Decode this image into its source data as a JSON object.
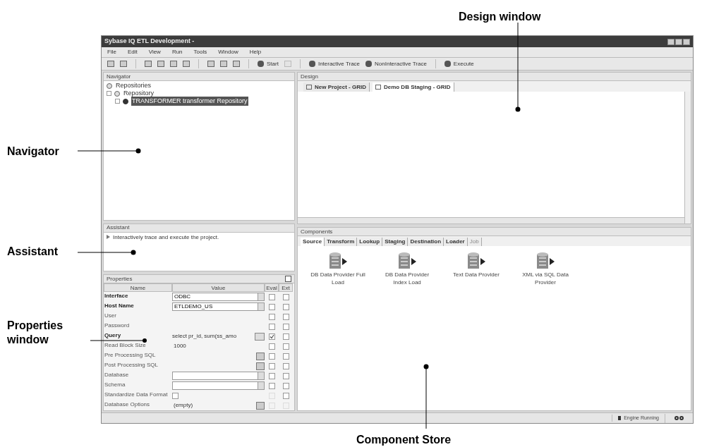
{
  "window": {
    "title": "Sybase IQ ETL Development -"
  },
  "menu": [
    "File",
    "Edit",
    "View",
    "Run",
    "Tools",
    "Window",
    "Help"
  ],
  "toolbar": [
    {
      "kind": "icon",
      "disabled": false
    },
    {
      "kind": "icon",
      "disabled": false
    },
    {
      "kind": "separator"
    },
    {
      "kind": "icon",
      "disabled": false
    },
    {
      "kind": "icon",
      "disabled": false
    },
    {
      "kind": "icon",
      "disabled": false
    },
    {
      "kind": "icon",
      "disabled": false
    },
    {
      "kind": "separator"
    },
    {
      "kind": "icon",
      "disabled": false
    },
    {
      "kind": "icon",
      "disabled": false
    },
    {
      "kind": "icon",
      "disabled": false
    },
    {
      "kind": "separator"
    },
    {
      "kind": "labeled",
      "label": "Start"
    },
    {
      "kind": "icon",
      "disabled": true
    },
    {
      "kind": "separator"
    },
    {
      "kind": "labeled",
      "label": "Interactive Trace"
    },
    {
      "kind": "labeled",
      "label": "NonInteractive Trace"
    },
    {
      "kind": "separator"
    },
    {
      "kind": "labeled",
      "label": "Execute"
    }
  ],
  "navigator": {
    "title": "Navigator",
    "tree": [
      {
        "label": "Repositories",
        "expanded": false,
        "selected": false
      },
      {
        "label": "Repository",
        "expanded": true,
        "selected": false,
        "children": [
          {
            "label": "TRANSFORMER transformer Repository",
            "expanded": false,
            "selected": true
          }
        ]
      }
    ]
  },
  "assistant": {
    "title": "Assistant",
    "text": "Interactively trace and execute the project."
  },
  "properties": {
    "title": "Properties",
    "columns": [
      "Name",
      "Value",
      "Eval",
      "Ext"
    ],
    "rows": [
      {
        "name": "Interface",
        "bold": true,
        "kind": "combo",
        "value": "ODBC",
        "eval": {
          "checked": false,
          "disabled": false
        },
        "ext": {
          "checked": false,
          "disabled": false
        }
      },
      {
        "name": "Host Name",
        "bold": true,
        "kind": "combo",
        "value": "ETLDEMO_US",
        "eval": {
          "checked": false,
          "disabled": false
        },
        "ext": {
          "checked": false,
          "disabled": false
        }
      },
      {
        "name": "User",
        "bold": false,
        "kind": "text",
        "value": "",
        "eval": {
          "checked": false,
          "disabled": false
        },
        "ext": {
          "checked": false,
          "disabled": false
        }
      },
      {
        "name": "Password",
        "bold": false,
        "kind": "text",
        "value": "",
        "eval": {
          "checked": false,
          "disabled": false
        },
        "ext": {
          "checked": false,
          "disabled": false
        }
      },
      {
        "name": "Query",
        "bold": true,
        "kind": "query",
        "value": "select pr_id, sum(ss_amo",
        "eval": {
          "checked": true,
          "disabled": false
        },
        "ext": {
          "checked": false,
          "disabled": false
        }
      },
      {
        "name": "Read Block Size",
        "bold": false,
        "kind": "text",
        "value": "1000",
        "eval": {
          "checked": false,
          "disabled": false
        },
        "ext": {
          "checked": false,
          "disabled": false
        }
      },
      {
        "name": "Pre Processing SQL",
        "bold": false,
        "kind": "editor",
        "value": "",
        "eval": {
          "checked": false,
          "disabled": false
        },
        "ext": {
          "checked": false,
          "disabled": false
        }
      },
      {
        "name": "Post Processing SQL",
        "bold": false,
        "kind": "editor",
        "value": "",
        "eval": {
          "checked": false,
          "disabled": false
        },
        "ext": {
          "checked": false,
          "disabled": false
        }
      },
      {
        "name": "Database",
        "bold": false,
        "kind": "combo",
        "value": "",
        "eval": {
          "checked": false,
          "disabled": false
        },
        "ext": {
          "checked": false,
          "disabled": false
        }
      },
      {
        "name": "Schema",
        "bold": false,
        "kind": "combo",
        "value": "",
        "eval": {
          "checked": false,
          "disabled": false
        },
        "ext": {
          "checked": false,
          "disabled": false
        }
      },
      {
        "name": "Standardize Data Format",
        "bold": false,
        "kind": "checkbox",
        "checked": false,
        "value": "",
        "eval": {
          "checked": false,
          "disabled": true
        },
        "ext": {
          "checked": false,
          "disabled": false
        }
      },
      {
        "name": "Database Options",
        "bold": false,
        "kind": "editor",
        "value": "(empty)",
        "eval": {
          "checked": false,
          "disabled": true
        },
        "ext": {
          "checked": false,
          "disabled": true
        }
      }
    ]
  },
  "design": {
    "title": "Design",
    "tabs": [
      {
        "label": "New Project - GRID",
        "selected": false
      },
      {
        "label": "Demo DB Staging - GRID",
        "selected": true
      }
    ]
  },
  "components": {
    "title": "Components",
    "tabs": [
      {
        "label": "Source",
        "selected": true,
        "disabled": false
      },
      {
        "label": "Transform",
        "selected": false,
        "disabled": false
      },
      {
        "label": "Lookup",
        "selected": false,
        "disabled": false
      },
      {
        "label": "Staging",
        "selected": false,
        "disabled": false
      },
      {
        "label": "Destination",
        "selected": false,
        "disabled": false
      },
      {
        "label": "Loader",
        "selected": false,
        "disabled": false
      },
      {
        "label": "Job",
        "selected": false,
        "disabled": true
      }
    ],
    "items": [
      "DB Data Provider Full Load",
      "DB Data Provider Index Load",
      "Text Data Provider",
      "XML via SQL Data Provider"
    ]
  },
  "status_bar": {
    "text": "Engine Running"
  },
  "callouts": [
    "Design window",
    "Navigator",
    "Assistant",
    "Properties window",
    "Component Store"
  ]
}
